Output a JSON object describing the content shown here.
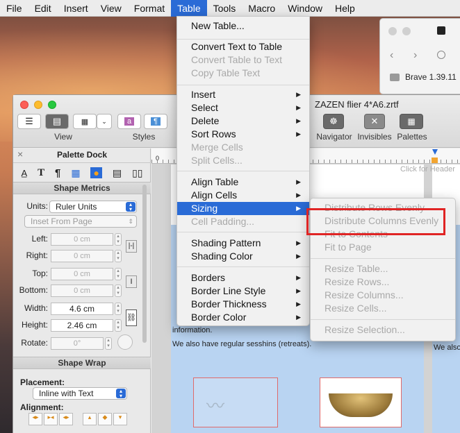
{
  "menubar": {
    "items": [
      "File",
      "Edit",
      "Insert",
      "View",
      "Format",
      "Table",
      "Tools",
      "Macro",
      "Window",
      "Help"
    ],
    "active": "Table"
  },
  "brave": {
    "title": "Brave 1.39.11"
  },
  "window": {
    "title": "ZAZEN flier 4*A6.zrtf"
  },
  "toolbar": {
    "view_label": "View",
    "styles_label": "Styles",
    "navigator_label": "Navigator",
    "invisibles_label": "Invisibles",
    "palettes_label": "Palettes"
  },
  "palette": {
    "title": "Palette Dock",
    "shape_metrics": "Shape Metrics",
    "units_label": "Units:",
    "units_value": "Ruler Units",
    "inset_value": "Inset From Page",
    "left_label": "Left:",
    "left_value": "0 cm",
    "right_label": "Right:",
    "right_value": "0 cm",
    "top_label": "Top:",
    "top_value": "0 cm",
    "bottom_label": "Bottom:",
    "bottom_value": "0 cm",
    "width_label": "Width:",
    "width_value": "4.6 cm",
    "height_label": "Height:",
    "height_value": "2.46 cm",
    "rotate_label": "Rotate:",
    "rotate_value": "0°",
    "shape_wrap": "Shape Wrap",
    "placement_label": "Placement:",
    "placement_value": "Inline with Text",
    "alignment_label": "Alignment:"
  },
  "document": {
    "header_hint": "Click for Header",
    "line_info": "information.",
    "line_sesshins": "We also have regular sesshins (retreats).",
    "right_cut": "We also"
  },
  "table_menu": {
    "items": [
      {
        "label": "New Table...",
        "enabled": true
      },
      {
        "label": "Convert Text to Table",
        "enabled": true
      },
      {
        "label": "Convert Table to Text",
        "enabled": false
      },
      {
        "label": "Copy Table Text",
        "enabled": false
      },
      {
        "label": "Insert",
        "enabled": true,
        "submenu": true
      },
      {
        "label": "Select",
        "enabled": true,
        "submenu": true
      },
      {
        "label": "Delete",
        "enabled": true,
        "submenu": true
      },
      {
        "label": "Sort Rows",
        "enabled": true,
        "submenu": true
      },
      {
        "label": "Merge Cells",
        "enabled": false
      },
      {
        "label": "Split Cells...",
        "enabled": false
      },
      {
        "label": "Align Table",
        "enabled": true,
        "submenu": true
      },
      {
        "label": "Align Cells",
        "enabled": true,
        "submenu": true
      },
      {
        "label": "Sizing",
        "enabled": true,
        "submenu": true,
        "selected": true
      },
      {
        "label": "Cell Padding...",
        "enabled": false
      },
      {
        "label": "Shading Pattern",
        "enabled": true,
        "submenu": true
      },
      {
        "label": "Shading Color",
        "enabled": true,
        "submenu": true
      },
      {
        "label": "Borders",
        "enabled": true,
        "submenu": true
      },
      {
        "label": "Border Line Style",
        "enabled": true,
        "submenu": true
      },
      {
        "label": "Border Thickness",
        "enabled": true,
        "submenu": true
      },
      {
        "label": "Border Color",
        "enabled": true,
        "submenu": true
      }
    ]
  },
  "sizing_menu": {
    "items": [
      "Distribute Rows Evenly",
      "Distribute Columns Evenly",
      "Fit to Contents",
      "Fit to Page",
      "Resize Table...",
      "Resize Rows...",
      "Resize Columns...",
      "Resize Cells...",
      "Resize Selection..."
    ]
  },
  "colors": {
    "accent": "#2a6bd6",
    "highlight_box": "#e02424"
  }
}
